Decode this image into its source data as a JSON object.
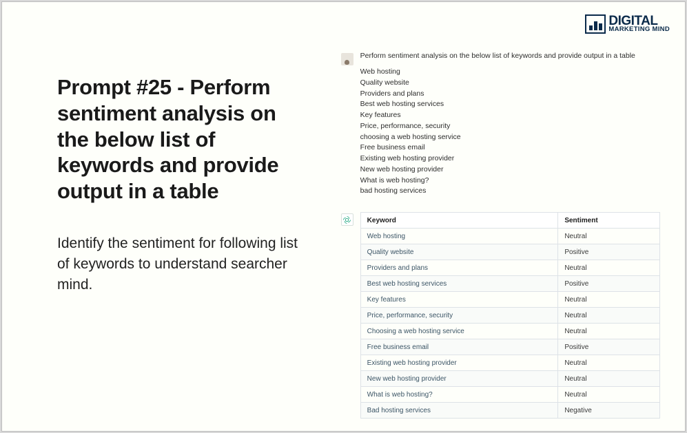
{
  "logo": {
    "line1": "DIGITAL",
    "line2": "MARKETING MIND"
  },
  "left": {
    "title": "Prompt #25 - Perform sentiment analysis on the below list of keywords and provide output in a table",
    "subtitle": "Identify the sentiment for following list of keywords to understand searcher mind."
  },
  "chat": {
    "user": {
      "prompt": "Perform sentiment analysis on the below list of keywords and provide output in a table",
      "keywords": [
        "Web hosting",
        "Quality website",
        "Providers and plans",
        "Best web hosting services",
        "Key features",
        "Price, performance, security",
        "choosing a web hosting service",
        "Free business email",
        "Existing web hosting provider",
        "New web hosting provider",
        "What is web hosting?",
        "bad hosting services"
      ]
    },
    "response": {
      "headers": {
        "col1": "Keyword",
        "col2": "Sentiment"
      },
      "rows": [
        {
          "keyword": "Web hosting",
          "sentiment": "Neutral"
        },
        {
          "keyword": "Quality website",
          "sentiment": "Positive"
        },
        {
          "keyword": "Providers and plans",
          "sentiment": "Neutral"
        },
        {
          "keyword": "Best web hosting services",
          "sentiment": "Positive"
        },
        {
          "keyword": "Key features",
          "sentiment": "Neutral"
        },
        {
          "keyword": "Price, performance, security",
          "sentiment": "Neutral"
        },
        {
          "keyword": "Choosing a web hosting service",
          "sentiment": "Neutral"
        },
        {
          "keyword": "Free business email",
          "sentiment": "Positive"
        },
        {
          "keyword": "Existing web hosting provider",
          "sentiment": "Neutral"
        },
        {
          "keyword": "New web hosting provider",
          "sentiment": "Neutral"
        },
        {
          "keyword": "What is web hosting?",
          "sentiment": "Neutral"
        },
        {
          "keyword": "Bad hosting services",
          "sentiment": "Negative"
        }
      ]
    }
  }
}
